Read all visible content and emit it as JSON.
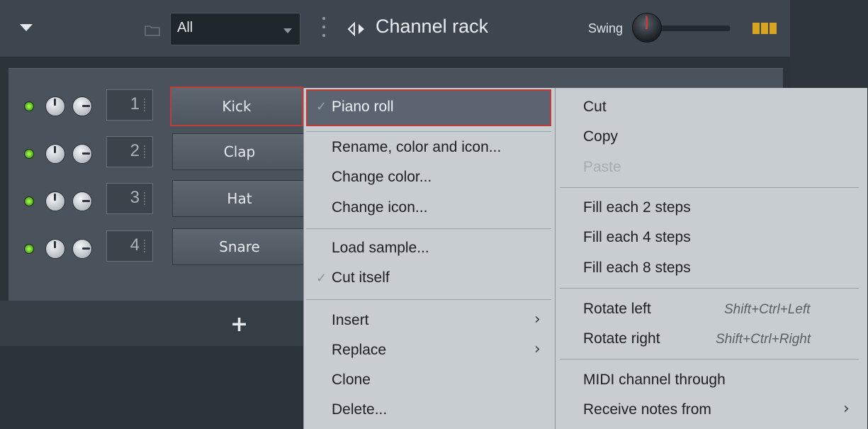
{
  "window": {
    "title": "Channel rack",
    "filter_value": "All",
    "swing_label": "Swing"
  },
  "channels": [
    {
      "number": "1",
      "name": "Kick"
    },
    {
      "number": "2",
      "name": "Clap"
    },
    {
      "number": "3",
      "name": "Hat"
    },
    {
      "number": "4",
      "name": "Snare"
    }
  ],
  "add_channel_label": "+",
  "context_menu": {
    "piano_roll": "Piano roll",
    "rename": "Rename, color and icon...",
    "change_color": "Change color...",
    "change_icon": "Change icon...",
    "load_sample": "Load sample...",
    "cut_itself": "Cut itself",
    "insert": "Insert",
    "replace": "Replace",
    "clone": "Clone",
    "delete": "Delete..."
  },
  "submenu": {
    "cut": "Cut",
    "copy": "Copy",
    "paste": "Paste",
    "fill_2": "Fill each 2 steps",
    "fill_4": "Fill each 4 steps",
    "fill_8": "Fill each 8 steps",
    "rotate_left": "Rotate left",
    "rotate_left_shortcut": "Shift+Ctrl+Left",
    "rotate_right": "Rotate right",
    "rotate_right_shortcut": "Shift+Ctrl+Right",
    "midi_through": "MIDI channel through",
    "receive_notes": "Receive notes from"
  },
  "colors": {
    "accent_led": "#5fbf27",
    "highlight_border": "#c23b3b",
    "grid_icon": "#d7a521"
  }
}
